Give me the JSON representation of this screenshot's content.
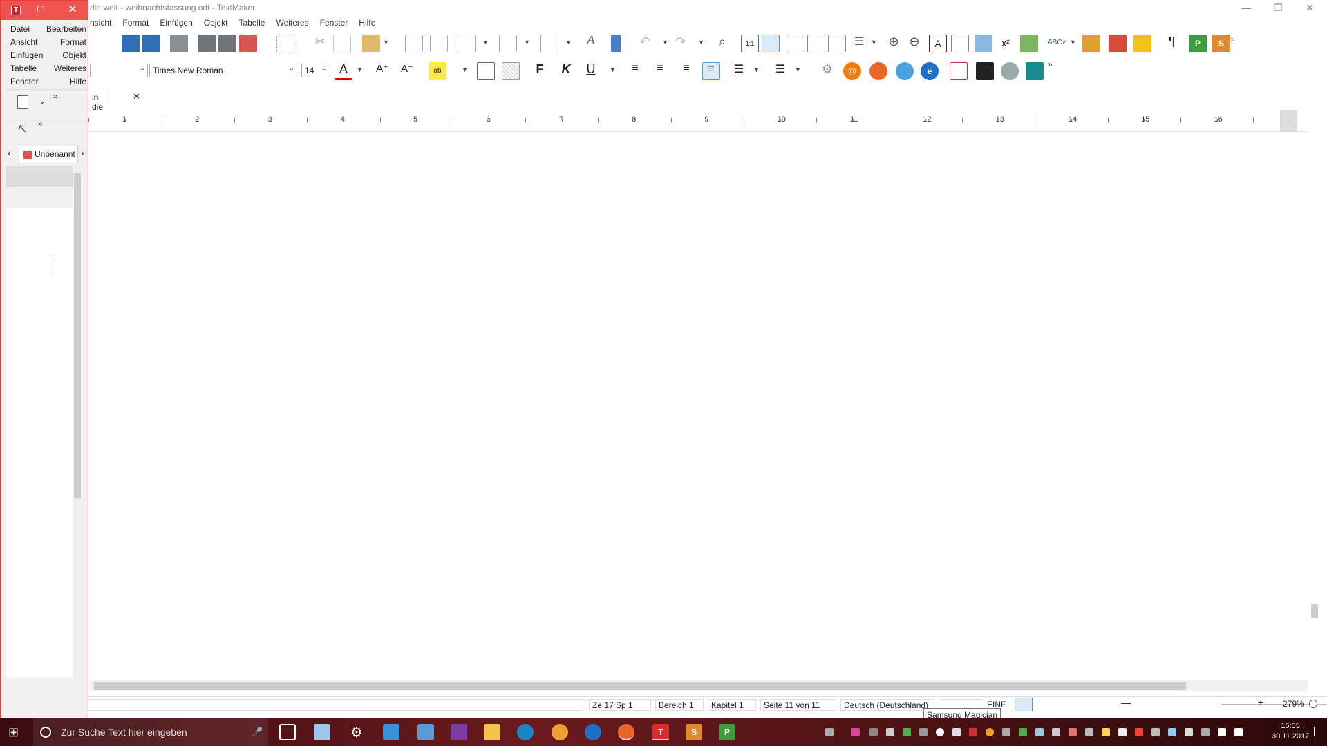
{
  "window": {
    "title": "die welt - weihnachtsfassung.odt - TextMaker"
  },
  "menu": {
    "items": [
      "nsicht",
      "Format",
      "Einfügen",
      "Objekt",
      "Tabelle",
      "Weiteres",
      "Fenster",
      "Hilfe"
    ]
  },
  "format_bar": {
    "style_value": "",
    "font_value": "Times New Roman",
    "size_value": "14"
  },
  "document_tab": {
    "label": "in die w..."
  },
  "ruler": {
    "numbers": [
      "1",
      "2",
      "3",
      "4",
      "5",
      "6",
      "7",
      "8",
      "9",
      "10",
      "11",
      "12",
      "13",
      "14",
      "15",
      "16"
    ]
  },
  "statusbar": {
    "position": "Ze 17 Sp 1",
    "section": "Bereich 1",
    "chapter": "Kapitel 1",
    "page": "Seite 11 von 11",
    "language": "Deutsch (Deutschland)",
    "mode": "EINF",
    "zoom": "279%",
    "tooltip": "Samsung Magician"
  },
  "mini_window": {
    "menu": [
      [
        "Datei",
        "Bearbeiten"
      ],
      [
        "Ansicht",
        "Format"
      ],
      [
        "Einfügen",
        "Objekt"
      ],
      [
        "Tabelle",
        "Weiteres"
      ],
      [
        "Fenster",
        "Hilfe"
      ]
    ],
    "tab_label": "Unbenannt"
  },
  "taskbar": {
    "search_placeholder": "Zur Suche Text hier eingeben",
    "clock_time": "15:05",
    "clock_date": "30.11.2017"
  },
  "colors": {
    "accent_red": "#ef5350",
    "taskbar": "#4a1214",
    "selection": "#dceaf8"
  }
}
